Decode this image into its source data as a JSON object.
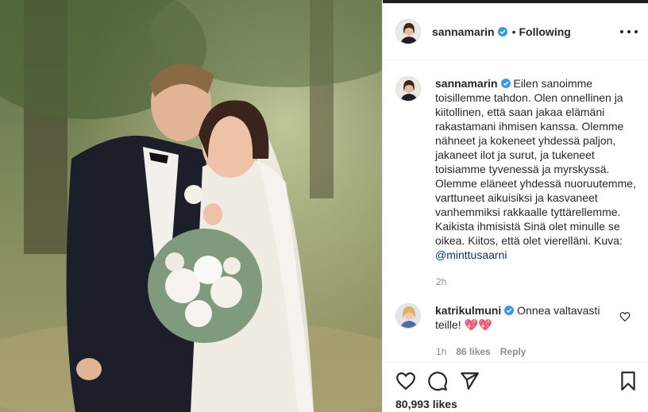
{
  "post": {
    "username": "sannamarin",
    "dot": "•",
    "follow_status": "Following",
    "caption": "Eilen sanoimme toisillemme tahdon. Olen onnellinen ja kiitollinen, että saan jakaa elämäni rakastamani ihmisen kanssa. Olemme nähneet ja kokeneet yhdessä paljon, jakaneet ilot ja surut, ja tukeneet toisiamme tyvenessä ja myrskyssä. Olemme eläneet yhdessä nuoruutemme, varttuneet aikuisiksi ja kasvaneet vanhemmiksi rakkaalle tyttärellemme. Kaikista ihmisistä Sinä olet minulle se oikea. Kiitos, että olet vierelläni. Kuva: ",
    "caption_mention": "@minttusaarni",
    "time": "2h",
    "likes": "80,993 likes"
  },
  "comment": {
    "username": "katrikulmuni",
    "text": "Onnea valtavasti teille! ",
    "emoji": "💖💖",
    "time": "1h",
    "likes": "86 likes",
    "reply": "Reply"
  },
  "colors": {
    "verified_blue": "#3897f0",
    "link": "#00376b",
    "muted": "#8e8e8e",
    "heart_red": "#ed4956"
  }
}
